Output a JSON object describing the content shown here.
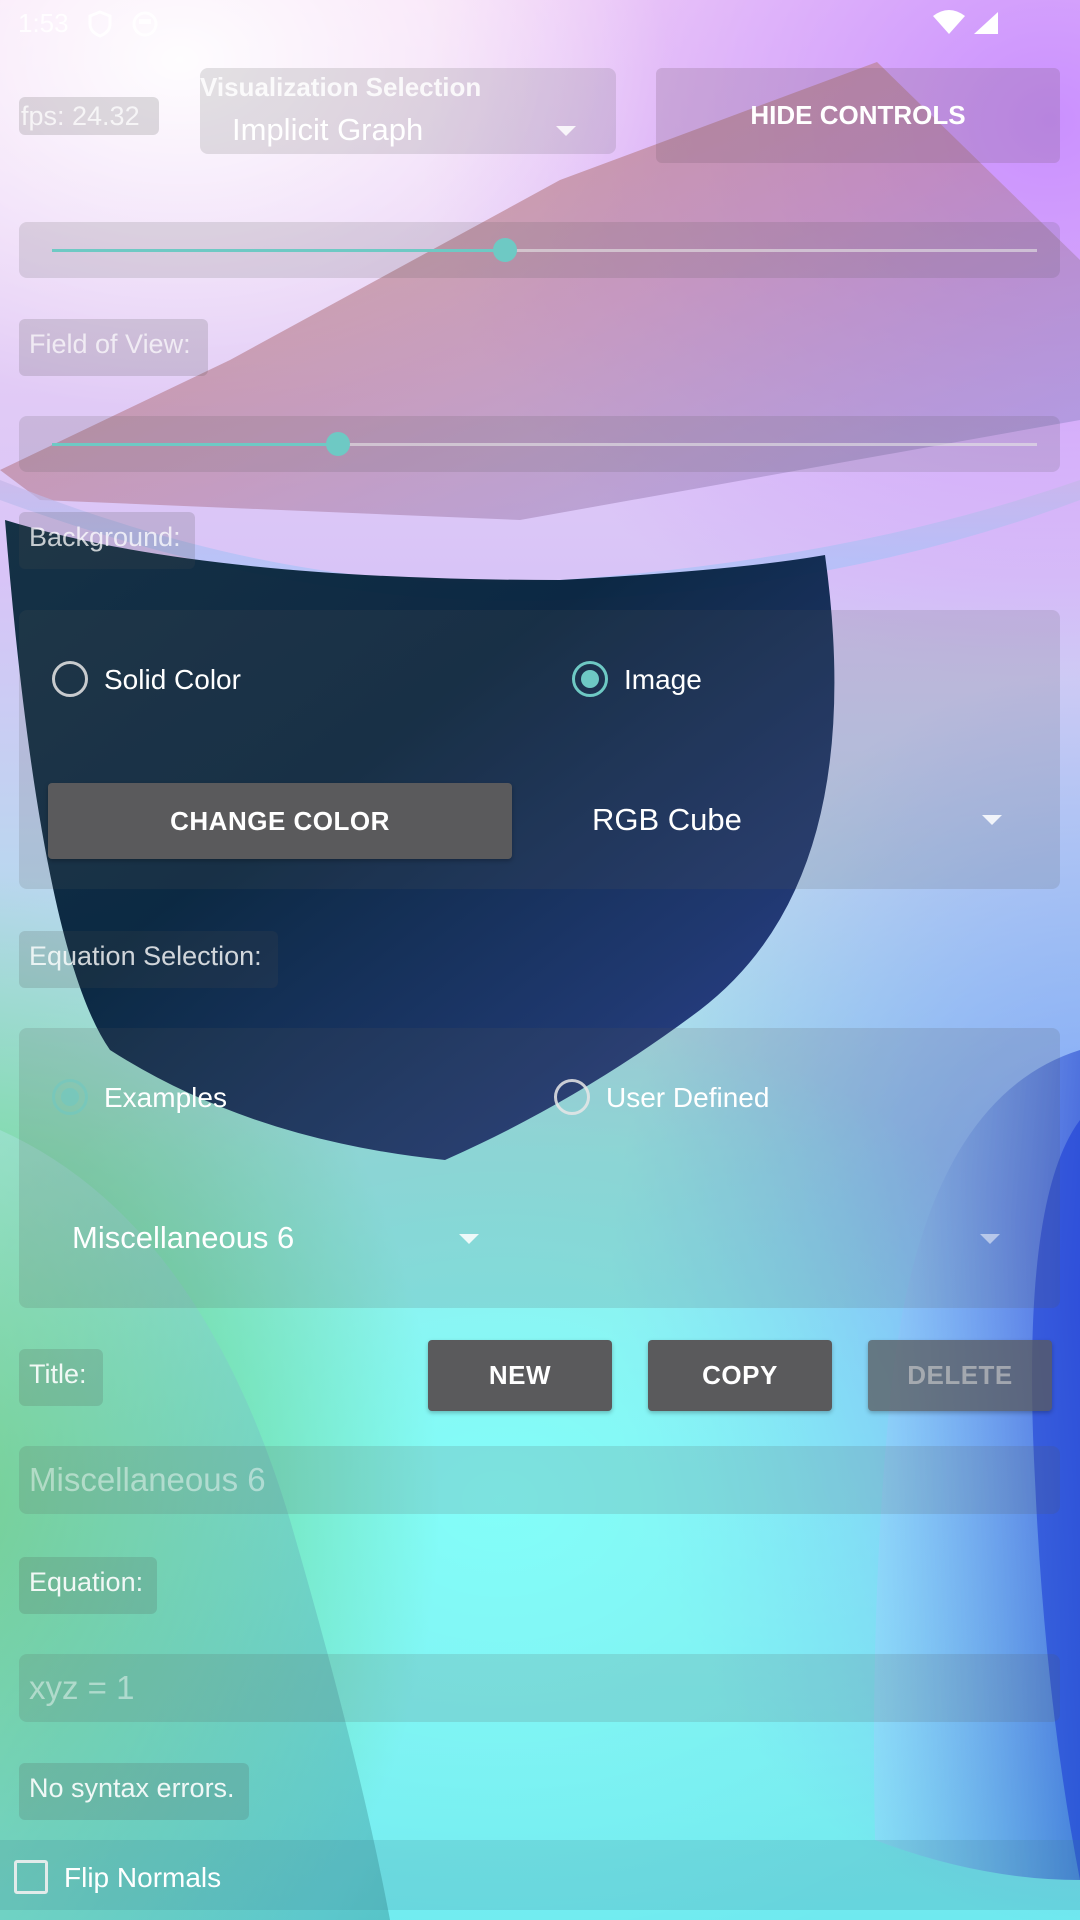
{
  "status_bar": {
    "time": "1:53"
  },
  "fps": "fps: 24.32",
  "visualization": {
    "label": "Visualization Selection",
    "value": "Implicit Graph"
  },
  "hide_controls": "HIDE CONTROLS",
  "sliders": {
    "top_value": 0.46,
    "fov_value": 0.29
  },
  "field_of_view_label": "Field of View:",
  "background": {
    "label": "Background:",
    "option_solid": "Solid Color",
    "option_image": "Image",
    "selected": "image",
    "change_color": "CHANGE COLOR",
    "image_value": "RGB Cube"
  },
  "equation_selection": {
    "label": "Equation Selection:",
    "option_examples": "Examples",
    "option_user": "User Defined",
    "selected": "examples",
    "example_value": "Miscellaneous 6",
    "user_value": ""
  },
  "title_section": {
    "label": "Title:",
    "new": "NEW",
    "copy": "COPY",
    "delete": "DELETE",
    "value": "Miscellaneous 6"
  },
  "equation": {
    "label": "Equation:",
    "value": "xyz = 1"
  },
  "syntax_status": "No syntax errors.",
  "flip_normals": {
    "label": "Flip Normals",
    "checked": false
  },
  "colors": {
    "accent": "#6ec9c4",
    "button": "#5a5a5c"
  }
}
